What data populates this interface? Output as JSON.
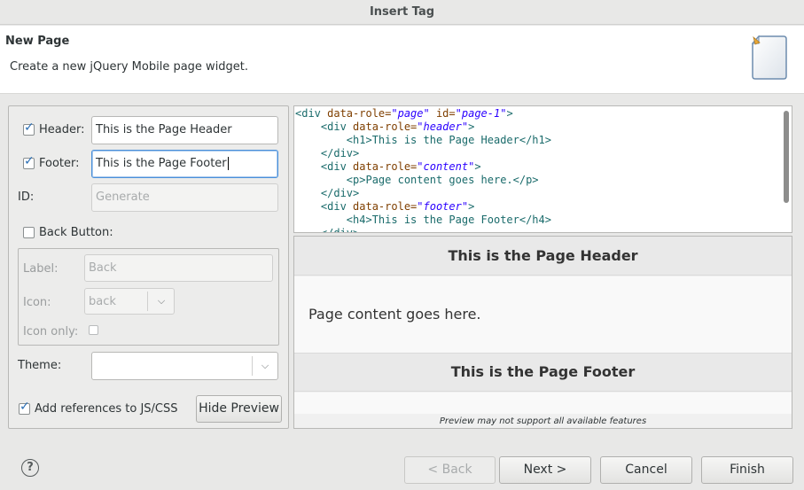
{
  "window": {
    "title": "Insert Tag"
  },
  "banner": {
    "title": "New Page",
    "description": "Create a new jQuery Mobile page widget.",
    "icon": "document-icon"
  },
  "form": {
    "header": {
      "label": "Header:",
      "value": "This is the Page Header",
      "checked": true
    },
    "footer": {
      "label": "Footer:",
      "value": "This is the Page Footer",
      "checked": true
    },
    "id": {
      "label": "ID:",
      "placeholder": "Generate"
    },
    "back_button": {
      "label": "Back Button:",
      "checked": false
    },
    "back_group": {
      "label_label": "Label:",
      "label_value": "Back",
      "icon_label": "Icon:",
      "icon_value": "back",
      "icon_only_label": "Icon only:"
    },
    "theme": {
      "label": "Theme:",
      "value": ""
    },
    "add_references": {
      "label": "Add references to JS/CSS",
      "checked": true
    },
    "hide_preview": "Hide Preview"
  },
  "code": {
    "lines": [
      {
        "indent": "",
        "open": "<div ",
        "a1": "data-role=",
        "v1": "\"page\"",
        "a2": " id=",
        "v2": "\"page-1\"",
        "close": ">"
      },
      {
        "indent": "    ",
        "open": "<div ",
        "a1": "data-role=",
        "v1": "\"header\"",
        "close": ">"
      },
      {
        "indent": "        ",
        "text": "<h1>This is the Page Header</h1>"
      },
      {
        "indent": "    ",
        "text": "</div>"
      },
      {
        "indent": "    ",
        "open": "<div ",
        "a1": "data-role=",
        "v1": "\"content\"",
        "close": ">"
      },
      {
        "indent": "        ",
        "text": "<p>Page content goes here.</p>"
      },
      {
        "indent": "    ",
        "text": "</div>"
      },
      {
        "indent": "    ",
        "open": "<div ",
        "a1": "data-role=",
        "v1": "\"footer\"",
        "close": ">"
      },
      {
        "indent": "        ",
        "text": "<h4>This is the Page Footer</h4>"
      },
      {
        "indent": "    ",
        "text": "</div>"
      }
    ]
  },
  "preview": {
    "header": "This is the Page Header",
    "content": "Page content goes here.",
    "footer": "This is the Page Footer",
    "note": "Preview may not support all available features"
  },
  "buttons": {
    "help": "?",
    "back": "< Back",
    "next": "Next >",
    "cancel": "Cancel",
    "finish": "Finish"
  }
}
